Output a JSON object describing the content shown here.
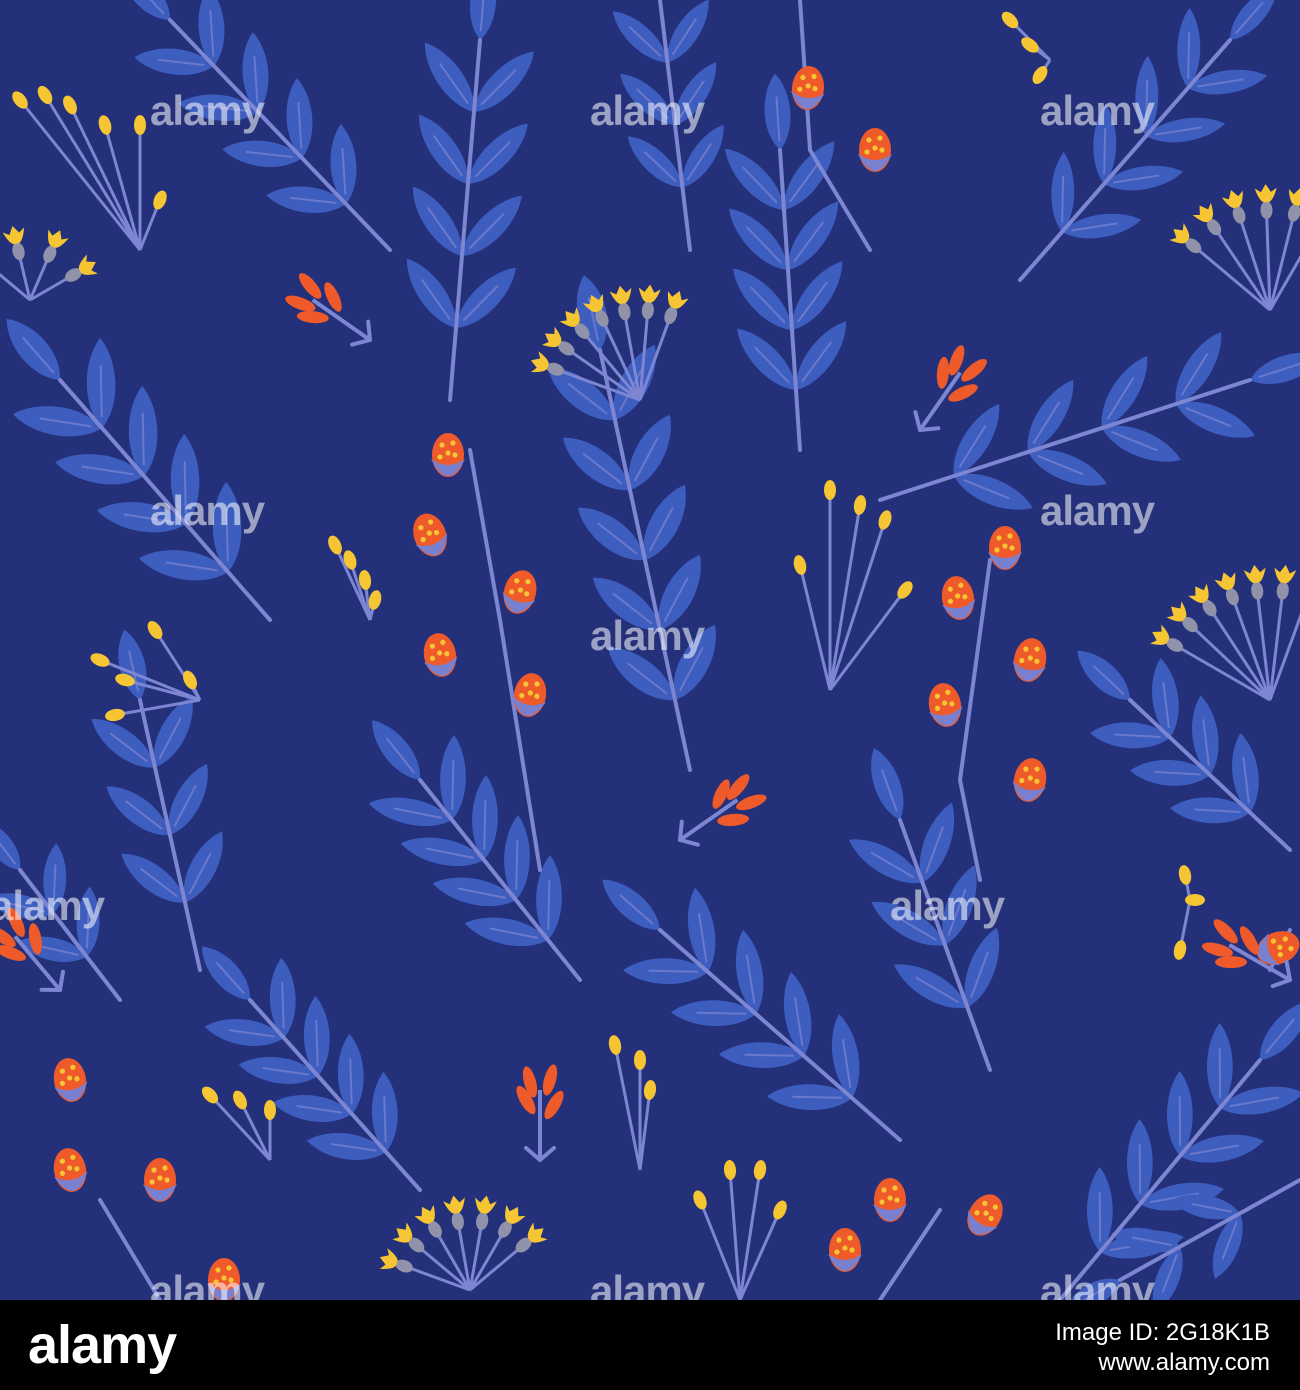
{
  "watermark": {
    "text": "alamy"
  },
  "footer": {
    "logo": "alamy",
    "image_id": "Image ID: 2G18K1B",
    "site": "www.alamy.com"
  },
  "colors": {
    "background": "#24317a",
    "leaf": "#3d5dbf",
    "stem": "#7d86d2",
    "yellow": "#f5c534",
    "orange": "#ef5a2b",
    "bud": "#7a80d0",
    "grey": "#8f92a8",
    "footer": "#000000"
  }
}
